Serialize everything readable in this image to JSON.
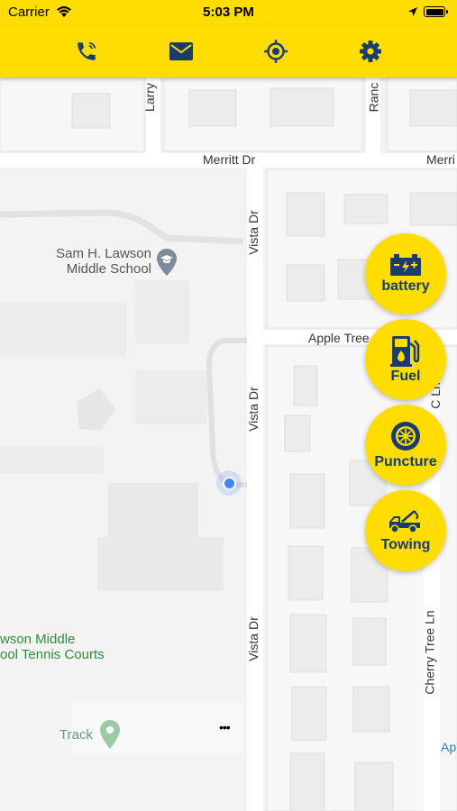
{
  "status_bar": {
    "carrier": "Carrier",
    "time": "5:03 PM"
  },
  "toolbar": {
    "icons": [
      "phone-icon",
      "mail-icon",
      "locate-icon",
      "settings-icon"
    ],
    "color": "#ffdd00",
    "icon_color": "#1a3c6e"
  },
  "map": {
    "roads": {
      "larry": "Larry",
      "ranc": "Ranc",
      "merritt_dr": "Merritt Dr",
      "merri": "Merri",
      "vista_dr_1": "Vista Dr",
      "vista_dr_2": "Vista Dr",
      "vista_dr_3": "Vista Dr",
      "apple_tree": "Apple Tree",
      "cherry_tree_ln": "Cherry Tree Ln",
      "c_ln": "C Ln",
      "ap": "Ap"
    },
    "pois": {
      "school_line1": "Sam H. Lawson",
      "school_line2": "Middle School",
      "tennis_line1": "wson Middle",
      "tennis_line2": "ool Tennis Courts",
      "track": "Track"
    },
    "more": "•••"
  },
  "services": [
    {
      "label": "battery",
      "icon": "battery-icon"
    },
    {
      "label": "Fuel",
      "icon": "fuel-icon"
    },
    {
      "label": "Puncture",
      "icon": "tire-icon"
    },
    {
      "label": "Towing",
      "icon": "tow-truck-icon"
    }
  ]
}
